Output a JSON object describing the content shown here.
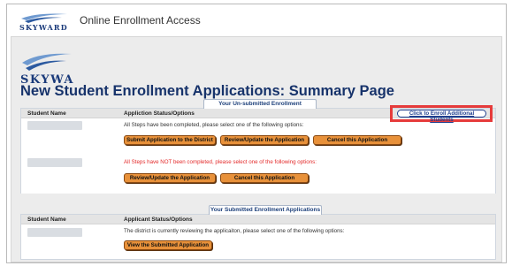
{
  "app": {
    "title": "Online Enrollment Access"
  },
  "page": {
    "title": "New Student Enrollment Applications: Summary Page"
  },
  "unsubmitted": {
    "tab_label": "Your Un-submitted Enrollment Applications",
    "col_student": "Student Name",
    "col_status": "Appliction Status/Options",
    "enroll_link": "Click to Enroll Additional Students",
    "rows": [
      {
        "message": "All Steps have been completed, please select one of the following options:",
        "buttons": [
          "Submit Application to the District",
          "Review/Update the Application",
          "Cancel this Application"
        ]
      },
      {
        "message": "All Steps have NOT been completed, please select one of the following options:",
        "buttons": [
          "Review/Update the Application",
          "Cancel this Application"
        ]
      }
    ]
  },
  "submitted": {
    "tab_label": "Your Submitted Enrollment Applications",
    "col_student": "Student Name",
    "col_status": "Applicant Status/Options",
    "rows": [
      {
        "message": "The district is currently reviewing the applicaiton, please select one of the following options:",
        "buttons": [
          "View the Submitted Application"
        ]
      }
    ]
  },
  "colors": {
    "title": "#17336b",
    "button": "#e8913a",
    "highlight": "#e63b3b",
    "warning": "#e32b2b"
  }
}
